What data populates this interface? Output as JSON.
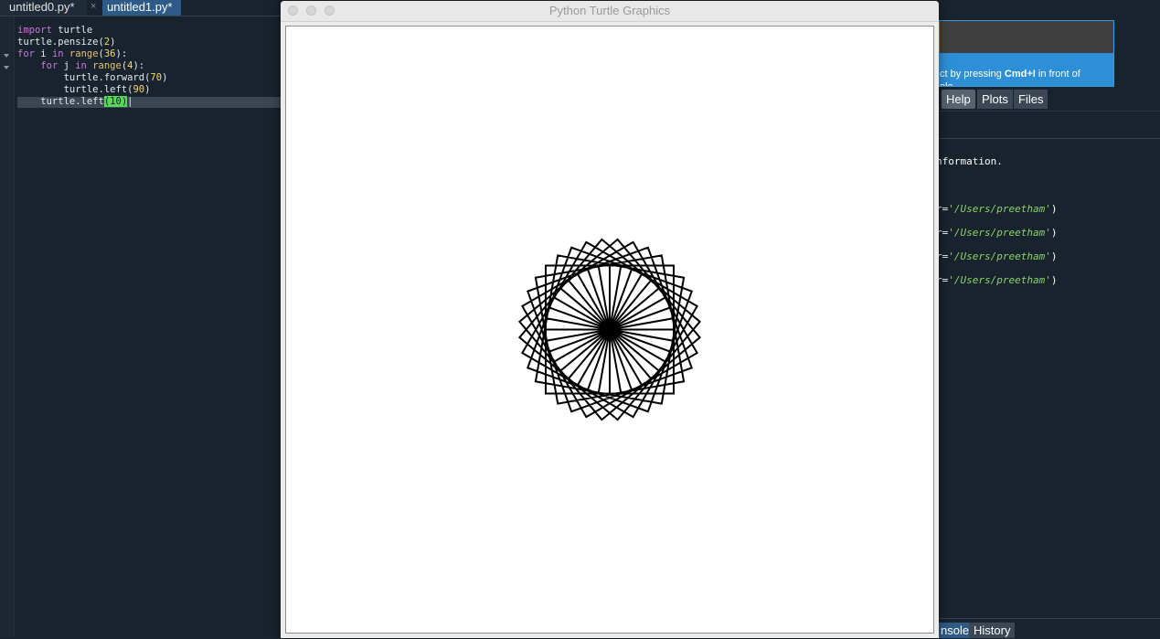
{
  "editor": {
    "tabs": [
      {
        "label": "untitled0.py*"
      },
      {
        "label": "untitled1.py*"
      }
    ],
    "tab_close_glyph": "×",
    "code": [
      {
        "segments": [
          {
            "t": "import",
            "c": "kw"
          },
          {
            "t": " turtle",
            "c": ""
          }
        ]
      },
      {
        "segments": [
          {
            "t": "turtle.pensize(",
            "c": ""
          },
          {
            "t": "2",
            "c": "num"
          },
          {
            "t": ")",
            "c": ""
          }
        ]
      },
      {
        "segments": [
          {
            "t": "for",
            "c": "kw"
          },
          {
            "t": " i ",
            "c": ""
          },
          {
            "t": "in",
            "c": "kw"
          },
          {
            "t": " ",
            "c": ""
          },
          {
            "t": "range",
            "c": "fn"
          },
          {
            "t": "(",
            "c": ""
          },
          {
            "t": "36",
            "c": "num"
          },
          {
            "t": "):",
            "c": ""
          }
        ]
      },
      {
        "segments": [
          {
            "t": "    ",
            "c": ""
          },
          {
            "t": "for",
            "c": "kw"
          },
          {
            "t": " j ",
            "c": ""
          },
          {
            "t": "in",
            "c": "kw"
          },
          {
            "t": " ",
            "c": ""
          },
          {
            "t": "range",
            "c": "fn"
          },
          {
            "t": "(",
            "c": ""
          },
          {
            "t": "4",
            "c": "num"
          },
          {
            "t": "):",
            "c": ""
          }
        ]
      },
      {
        "segments": [
          {
            "t": "        turtle.forward(",
            "c": ""
          },
          {
            "t": "70",
            "c": "num"
          },
          {
            "t": ")",
            "c": ""
          }
        ]
      },
      {
        "segments": [
          {
            "t": "        turtle.left(",
            "c": ""
          },
          {
            "t": "90",
            "c": "num"
          },
          {
            "t": ")",
            "c": ""
          }
        ]
      },
      {
        "segments": [
          {
            "t": "    turtle.left",
            "c": ""
          },
          {
            "t": "(",
            "c": "br"
          },
          {
            "t": "10",
            "c": "num br"
          },
          {
            "t": ")",
            "c": "br"
          },
          {
            "t": "|",
            "c": ""
          }
        ]
      }
    ]
  },
  "help_panel": {
    "text_prefix": "ct by pressing ",
    "shortcut": "Cmd+I",
    "text_suffix": " in front of",
    "text_line2": "ole"
  },
  "pane_tabs": [
    {
      "label": "Help",
      "active": true
    },
    {
      "label": "Plots",
      "active": false
    },
    {
      "label": "Files",
      "active": false
    }
  ],
  "console": {
    "info_line": "nformation.",
    "runfile_prefix": "r=",
    "runfile_dir": "'/Users/preetham'",
    "runfile_suffix": ")",
    "runfile_count": 4
  },
  "bottom_tabs": [
    {
      "label": "nsole",
      "active": true
    },
    {
      "label": "History",
      "active": false
    }
  ],
  "turtle_window": {
    "title": "Python Turtle Graphics",
    "drawing": {
      "repeats": 36,
      "sides": 4,
      "side_length": 70,
      "inner_turn_deg": 90,
      "outer_turn_deg": 10,
      "pensize": 2,
      "pen_color": "#000000"
    }
  }
}
